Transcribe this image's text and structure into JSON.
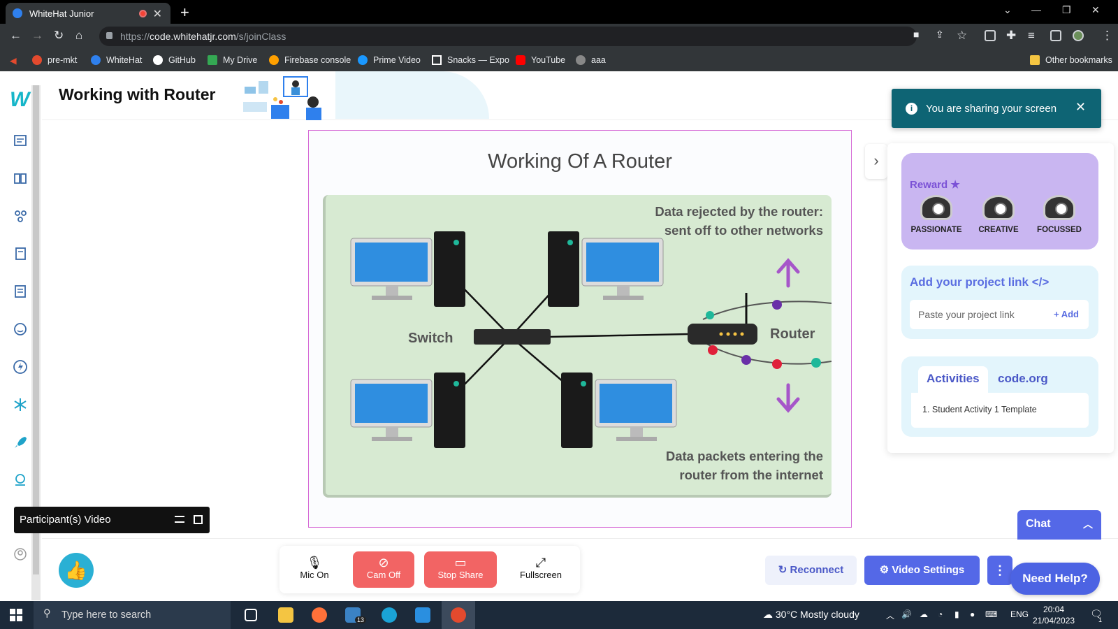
{
  "browser": {
    "tab_title": "WhiteHat Junior",
    "url_prefix": "https://",
    "url_domain": "code.whitehatjr.com",
    "url_path": "/s/joinClass",
    "bookmarks": [
      "pre-mkt",
      "WhiteHat",
      "GitHub",
      "My Drive",
      "Firebase console",
      "Prime Video",
      "Snacks — Expo",
      "YouTube",
      "aaa"
    ],
    "other_bookmarks": "Other bookmarks"
  },
  "header": {
    "title": "Working with Router"
  },
  "slide": {
    "title": "Working Of A Router",
    "rejected_line1": "Data rejected by the router:",
    "rejected_line2": "sent off to other networks",
    "entering_line1": "Data packets entering the",
    "entering_line2": "router from the internet",
    "switch_label": "Switch",
    "router_label": "Router"
  },
  "toast": {
    "message": "You are sharing your screen"
  },
  "reward": {
    "title": "Reward",
    "badges": [
      "PASSIONATE",
      "CREATIVE",
      "FOCUSSED"
    ]
  },
  "project": {
    "title": "Add your project link </>",
    "placeholder": "Paste your project link",
    "add_label": "+ Add"
  },
  "activities": {
    "tabs": [
      "Activities",
      "code.org"
    ],
    "items": [
      "1. Student Activity 1 Template"
    ]
  },
  "participant_video": "Participant(s) Video",
  "controls": {
    "mic": "Mic On",
    "cam": "Cam Off",
    "share": "Stop Share",
    "fullscreen": "Fullscreen"
  },
  "actions": {
    "reconnect": "Reconnect",
    "video_settings": "Video Settings",
    "chat": "Chat",
    "help": "Need Help?"
  },
  "taskbar": {
    "search_placeholder": "Type here to search",
    "weather": "30°C  Mostly cloudy",
    "lang": "ENG",
    "time": "20:04",
    "date": "21/04/2023",
    "mail_count": "13",
    "notifications": "1"
  },
  "colors": {
    "accent": "#5468e7",
    "toast": "#0e6474",
    "danger": "#f26464",
    "slide_border": "#d66ad6",
    "arrow_purple": "#a656c9"
  }
}
